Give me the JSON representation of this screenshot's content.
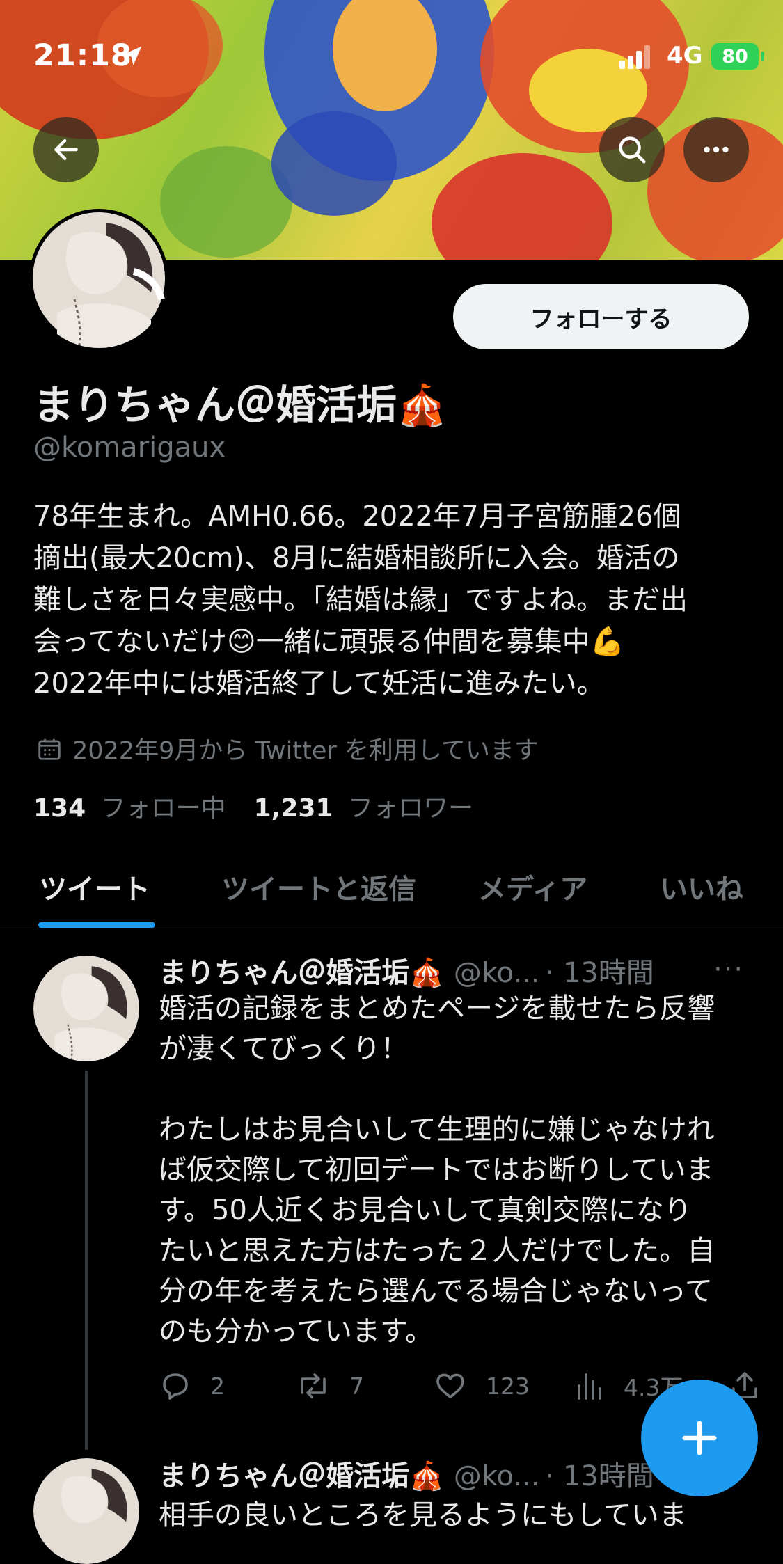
{
  "status_bar": {
    "time": "21:18",
    "network": "4G",
    "battery": "80"
  },
  "profile": {
    "display_name": "まりちゃん＠婚活垢",
    "name_emoji": "🎪",
    "handle": "@komarigaux",
    "follow_label": "フォローする",
    "bio": "78年生まれ。AMH0.66。2022年7月子宮筋腫26個\n摘出(最大20cm)、8月に結婚相談所に入会。婚活の\n難しさを日々実感中。「結婚は縁」ですよね。まだ出\n会ってないだけ😊一緒に頑張る仲間を募集中💪\n2022年中には婚活終了して妊活に進みたい。",
    "joined": "2022年9月から Twitter を利用しています",
    "following_count": "134",
    "following_label": "フォロー中",
    "followers_count": "1,231",
    "followers_label": "フォロワー"
  },
  "tabs": [
    {
      "label": "ツイート",
      "active": true
    },
    {
      "label": "ツイートと返信",
      "active": false
    },
    {
      "label": "メディア",
      "active": false
    },
    {
      "label": "いいね",
      "active": false
    }
  ],
  "tweets": [
    {
      "author": "まりちゃん＠婚活垢",
      "author_emoji": "🎪",
      "handle": "@ko...",
      "time": "· 13時間",
      "more": "···",
      "text": "婚活の記録をまとめたページを載せたら反響\nが凄くてびっくり！\n\nわたしはお見合いして生理的に嫌じゃなけれ\nば仮交際して初回デートではお断りしていま\nす。50人近くお見合いして真剣交際になり\nたいと思えた方はたった２人だけでした。自\n分の年を考えたら選んでる場合じゃないって\nのも分かっています。",
      "replies": "2",
      "retweets": "7",
      "likes": "123",
      "views": "4.3万"
    },
    {
      "author": "まりちゃん＠婚活垢",
      "author_emoji": "🎪",
      "handle": "@ko...",
      "time": "· 13時間",
      "text_partial": "相手の良いところを見るようにもしていま"
    }
  ],
  "colors": {
    "accent": "#1d9bf0",
    "background": "#000000",
    "muted": "#71767b",
    "text": "#e7e9ea"
  },
  "icons": [
    "back-arrow-icon",
    "search-icon",
    "more-icon",
    "calendar-icon",
    "reply-icon",
    "retweet-icon",
    "like-icon",
    "views-icon",
    "share-icon",
    "compose-plus-icon",
    "location-arrow-icon",
    "signal-icon"
  ]
}
